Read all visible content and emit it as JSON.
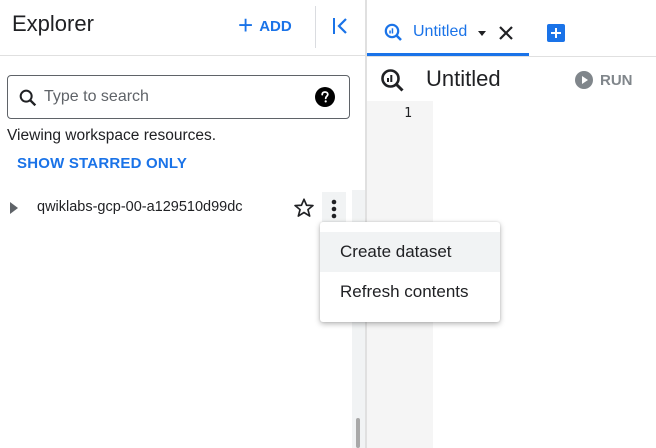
{
  "explorer": {
    "title": "Explorer",
    "add_label": "ADD",
    "search": {
      "placeholder": "Type to search",
      "value": ""
    },
    "viewing_text": "Viewing workspace resources.",
    "show_starred_label": "SHOW STARRED ONLY",
    "projects": [
      {
        "name": "qwiklabs-gcp-00-a129510d99dc",
        "starred": false
      }
    ]
  },
  "context_menu": {
    "items": [
      {
        "label": "Create dataset",
        "highlighted": true
      },
      {
        "label": "Refresh contents",
        "highlighted": false
      }
    ]
  },
  "editor": {
    "tab": {
      "label": "Untitled"
    },
    "title": "Untitled",
    "run_label": "RUN",
    "line_numbers": [
      "1"
    ]
  },
  "colors": {
    "accent": "#1a73e8",
    "text": "#202124",
    "muted": "#5f6368",
    "disabled": "#80868b",
    "divider": "#e0e0e0",
    "hover": "#f1f3f4"
  },
  "icons": [
    "plus-icon",
    "collapse-panel-icon",
    "search-icon",
    "help-icon",
    "expand-arrow-icon",
    "star-outline-icon",
    "more-vert-icon",
    "query-icon",
    "dropdown-arrow-icon",
    "close-icon",
    "new-tab-icon",
    "play-icon"
  ]
}
